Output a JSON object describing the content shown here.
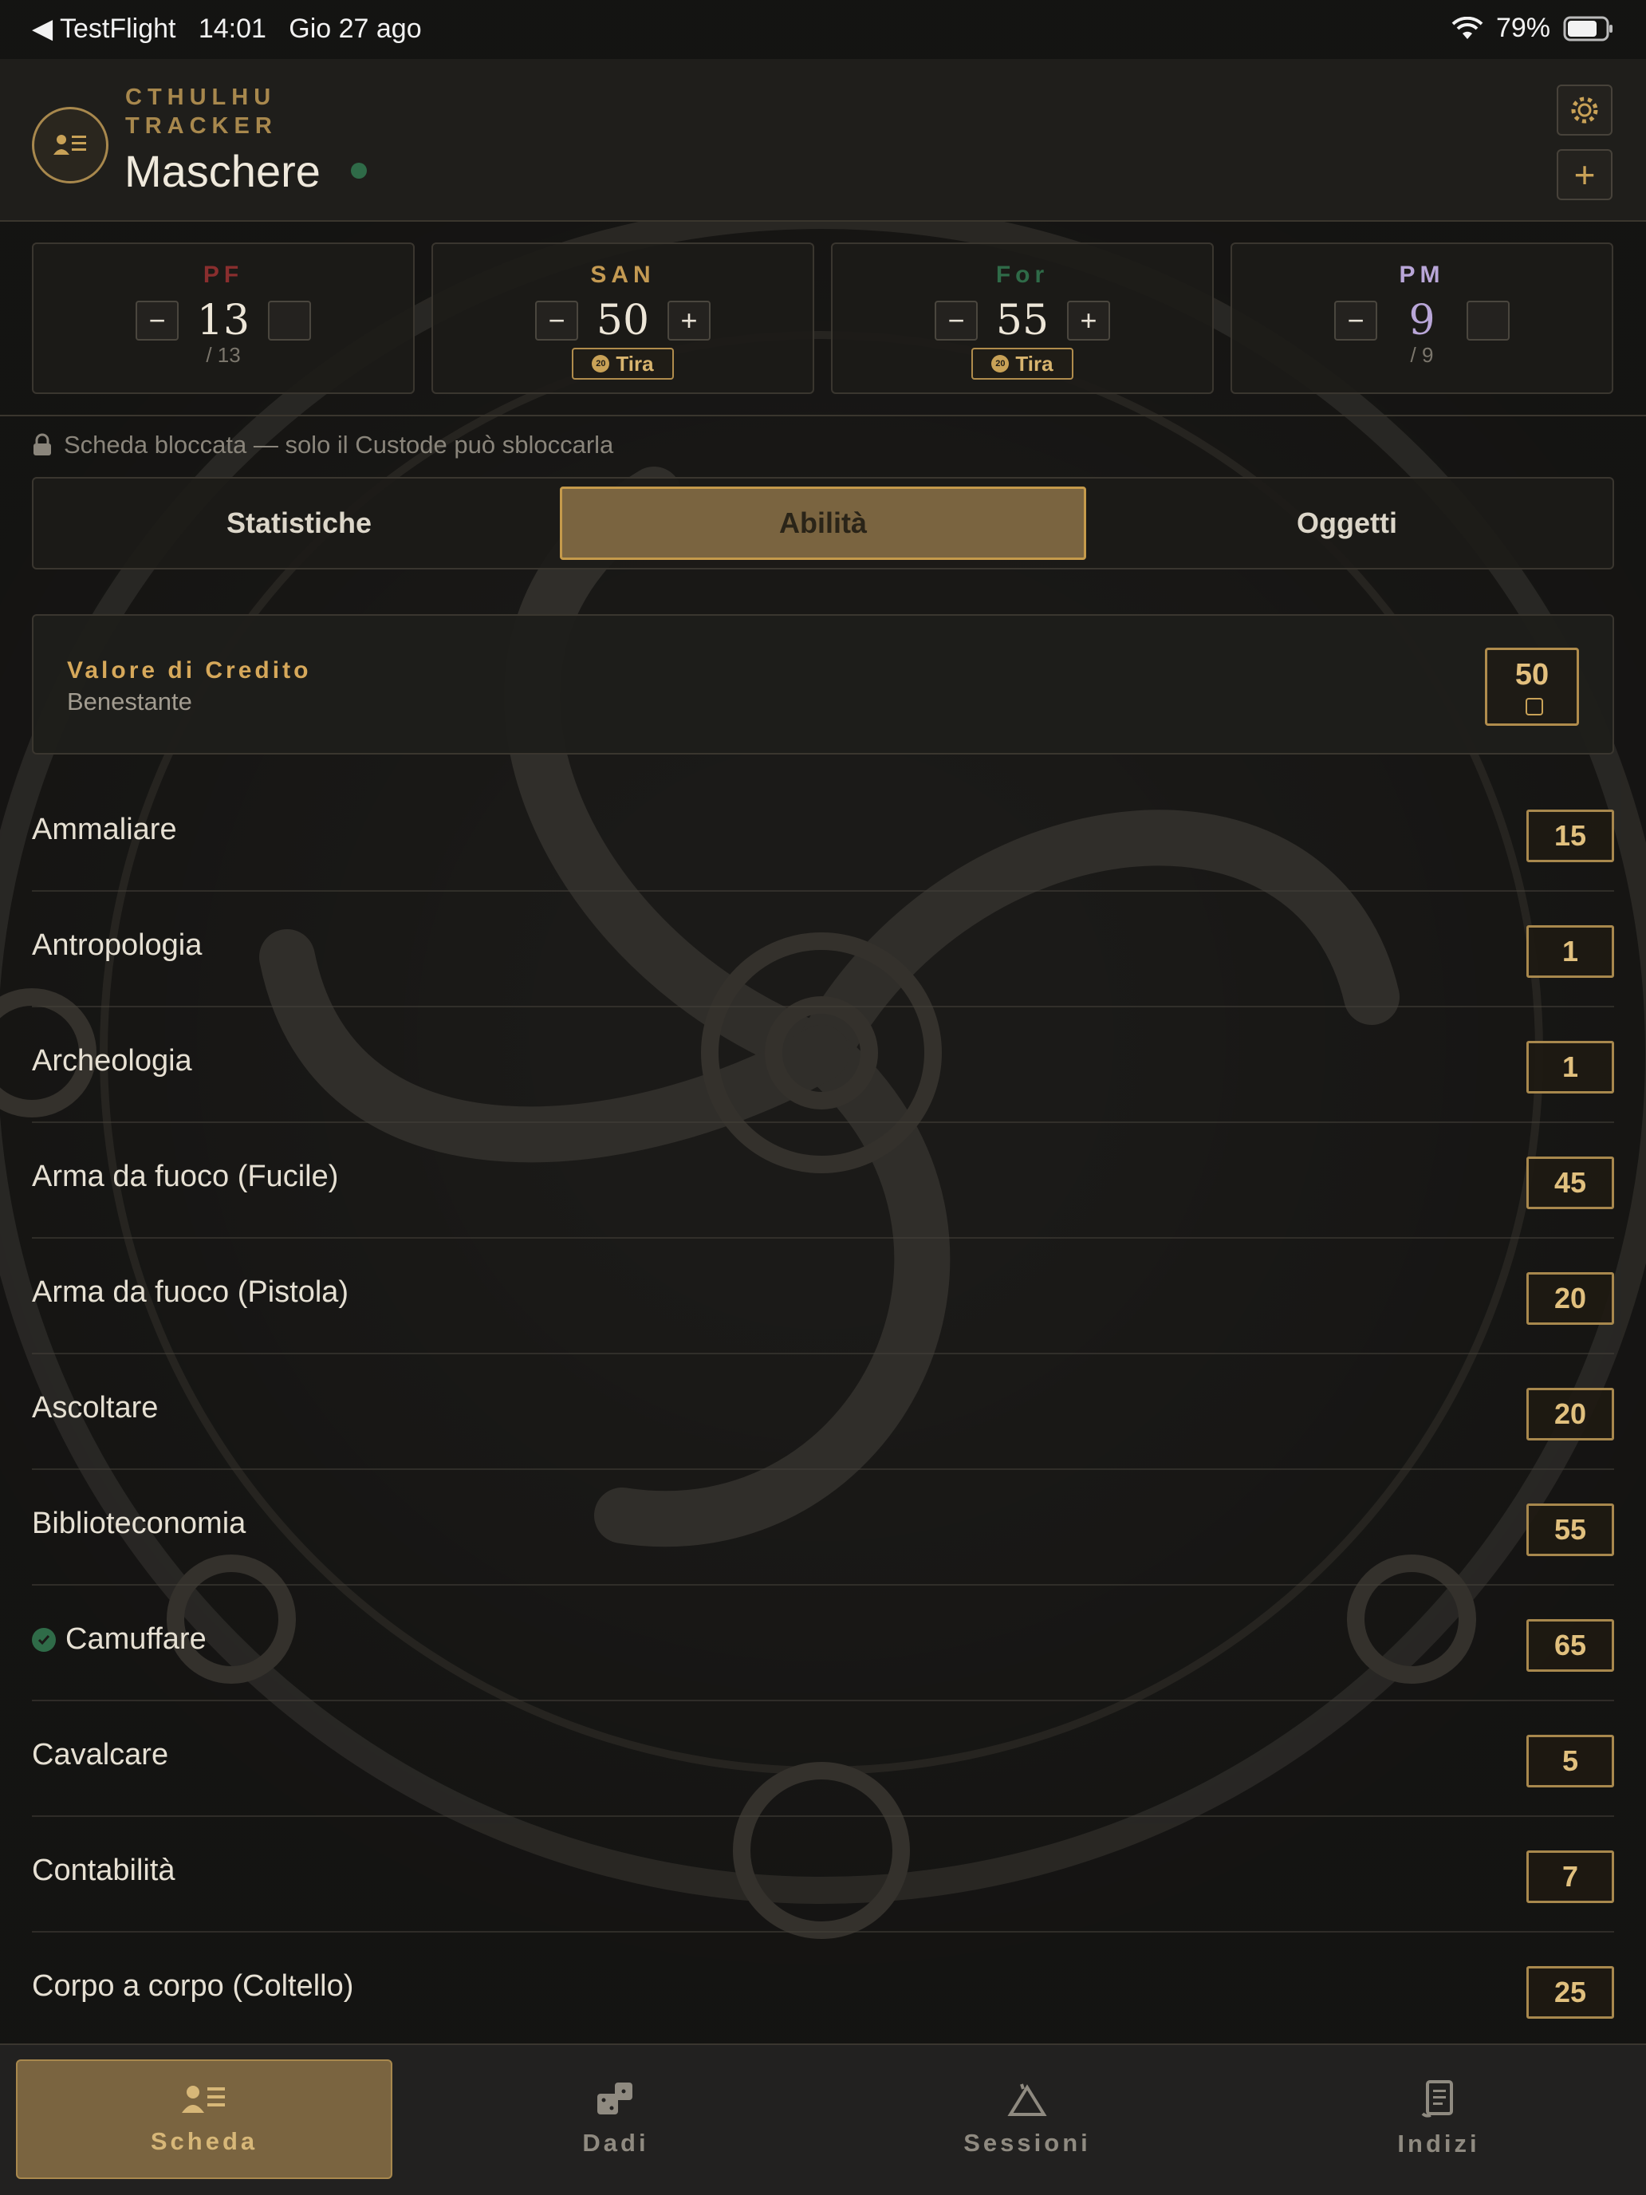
{
  "status_bar": {
    "back_app": "◀ TestFlight",
    "time": "14:01",
    "date": "Gio 27 ago",
    "battery": "79%"
  },
  "header": {
    "brand": "CTHULHU TRACKER",
    "title": "Maschere",
    "settings_icon": "gear-icon",
    "add_label": "+"
  },
  "stats": [
    {
      "label": "PF",
      "value": "13",
      "max": "/ 13",
      "color": "#8a2e2e"
    },
    {
      "label": "SAN",
      "value": "50",
      "roll": "Tira",
      "color": "#c49a52"
    },
    {
      "label": "For",
      "value": "55",
      "roll": "Tira",
      "color": "#2f6b48"
    },
    {
      "label": "PM",
      "value": "9",
      "max": "/ 9",
      "color": "#b9a6d8"
    }
  ],
  "lock_notice": "Scheda bloccata — solo il Custode può sbloccarla",
  "tabs": [
    {
      "label": "Statistiche",
      "active": false
    },
    {
      "label": "Abilità",
      "active": true
    },
    {
      "label": "Oggetti",
      "active": false
    }
  ],
  "credit": {
    "title": "Valore di Credito",
    "subtitle": "Benestante",
    "value": "50"
  },
  "skills": [
    {
      "name": "Ammaliare",
      "value": "15"
    },
    {
      "name": "Antropologia",
      "value": "1"
    },
    {
      "name": "Archeologia",
      "value": "1"
    },
    {
      "name": "Arma da fuoco (Fucile)",
      "value": "45"
    },
    {
      "name": "Arma da fuoco (Pistola)",
      "value": "20"
    },
    {
      "name": "Ascoltare",
      "value": "20"
    },
    {
      "name": "Biblioteconomia",
      "value": "55"
    },
    {
      "name": "Camuffare",
      "value": "65",
      "checked": true
    },
    {
      "name": "Cavalcare",
      "value": "5"
    },
    {
      "name": "Contabilità",
      "value": "7"
    },
    {
      "name": "Corpo a corpo (Coltello)",
      "value": "25"
    }
  ],
  "tab_bar": [
    {
      "label": "Scheda",
      "icon": "character-sheet-icon",
      "active": true
    },
    {
      "label": "Dadi",
      "icon": "dice-icon",
      "active": false
    },
    {
      "label": "Sessioni",
      "icon": "tent-icon",
      "active": false
    },
    {
      "label": "Indizi",
      "icon": "clue-document-icon",
      "active": false
    }
  ],
  "accent_color": "#c9a257"
}
